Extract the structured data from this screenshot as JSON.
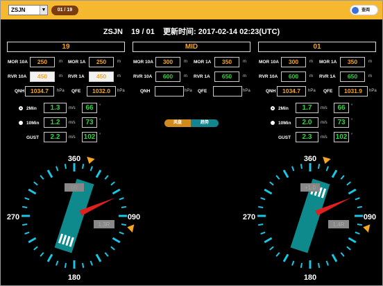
{
  "toolbar": {
    "station_select": "ZSJN",
    "page_counter": "01 / 19",
    "user_label": "查阅"
  },
  "header": {
    "station": "ZSJN",
    "runways": "19 / 01",
    "update_label": "更新时间:",
    "update_time": "2017-02-14 02:23(UTC)"
  },
  "labels": {
    "mor10a": "MOR 10A",
    "mor1a": "MOR 1A",
    "rvr10a": "RVR 10A",
    "rvr1a": "RVR 1A",
    "qnh": "QNH",
    "qfe": "QFE",
    "twomin": "2Min",
    "tenmin": "10Min",
    "gust": "GUST",
    "unit_m": "m",
    "unit_hpa": "hPa",
    "unit_ms": "m/s",
    "unit_deg": "°"
  },
  "runway19": {
    "title": "19",
    "mor10a": "250",
    "mor1a": "250",
    "rvr10a": "450",
    "rvr1a": "450",
    "qnh": "1034.7",
    "qfe": "1032.0",
    "wind2min_speed": "1.3",
    "wind2min_dir": "66",
    "wind10min_speed": "1.2",
    "wind10min_dir": "73",
    "gust_speed": "2.2",
    "gust_dir": "102"
  },
  "mid": {
    "title": "MID",
    "mor10a": "300",
    "mor1a": "350",
    "rvr10a": "600",
    "rvr1a": "650",
    "qnh": "",
    "qfe": ""
  },
  "runway01": {
    "title": "01",
    "mor10a": "300",
    "mor1a": "350",
    "rvr10a": "600",
    "rvr1a": "650",
    "qnh": "1034.7",
    "qfe": "1031.9",
    "wind2min_speed": "1.7",
    "wind2min_dir": "66",
    "wind10min_speed": "2.0",
    "wind10min_dir": "73",
    "gust_speed": "2.3",
    "gust_dir": "102"
  },
  "buttons": {
    "wind_dial": "风盘",
    "trend": "趋势"
  },
  "compass_left": {
    "n": "360",
    "e": "090",
    "s": "180",
    "w": "270",
    "head_tag": "0R",
    "cross_tag": "1.3R",
    "wind_dir": 66,
    "runway_heading": 190
  },
  "compass_right": {
    "n": "360",
    "e": "090",
    "s": "180",
    "w": "270",
    "head_tag": "+1.0",
    "cross_tag": "1.4R",
    "wind_dir": 66,
    "runway_heading": 10
  },
  "colors": {
    "accent": "#f5b82e",
    "value_orange": "#f5a623",
    "value_green": "#2cd63c",
    "tick_cyan": "#19c8e6",
    "runway_teal": "#0f8a8c",
    "wind_red": "#e02020"
  }
}
